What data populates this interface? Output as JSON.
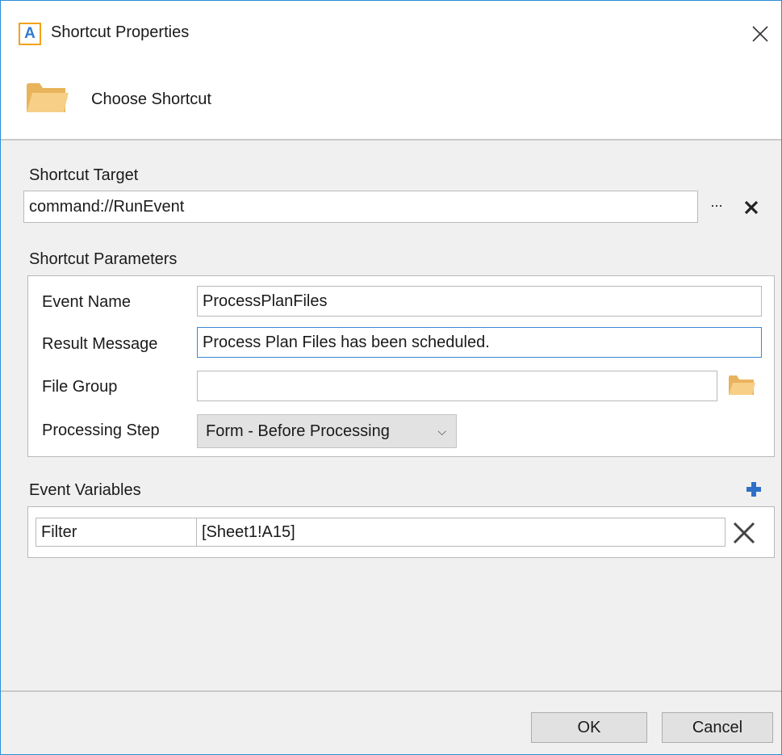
{
  "window": {
    "title": "Shortcut Properties",
    "app_icon_letter": "A"
  },
  "header": {
    "title": "Choose Shortcut"
  },
  "target": {
    "label": "Shortcut Target",
    "value": "command://RunEvent",
    "browse_label": "..."
  },
  "parameters": {
    "label": "Shortcut Parameters",
    "event_name_label": "Event Name",
    "event_name_value": "ProcessPlanFiles",
    "result_message_label": "Result Message",
    "result_message_value": "Process Plan Files has been scheduled.",
    "file_group_label": "File Group",
    "file_group_value": "",
    "processing_step_label": "Processing Step",
    "processing_step_value": "Form - Before Processing"
  },
  "variables": {
    "label": "Event Variables",
    "rows": [
      {
        "name": "Filter",
        "value": "[Sheet1!A15]"
      }
    ]
  },
  "footer": {
    "ok_label": "OK",
    "cancel_label": "Cancel"
  },
  "colors": {
    "window_border": "#2b8fd6",
    "focus_border": "#3a87d8",
    "folder": "#f5c87a",
    "plus": "#2f6fc7",
    "app_icon_border": "#f0a31a"
  }
}
